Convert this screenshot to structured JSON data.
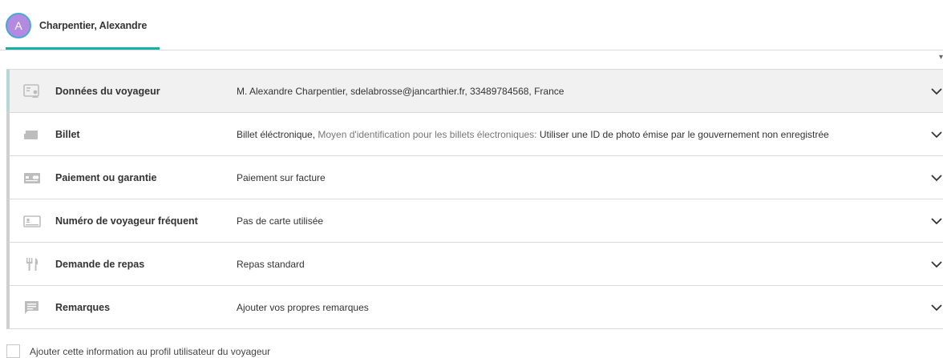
{
  "tab": {
    "avatar_letter": "A",
    "name": "Charpentier, Alexandre"
  },
  "rows": [
    {
      "title": "Données du voyageur",
      "value": "M. Alexandre Charpentier, sdelabrosse@jancarthier.fr, 33489784568, France",
      "icon": "id-card-icon"
    },
    {
      "title": "Billet",
      "value_prefix": "Billet éléctronique, ",
      "value_muted": "Moyen d'identification pour les billets électroniques: ",
      "value_suffix": "Utiliser une ID de photo émise par le gouvernement non enregistrée",
      "icon": "ticket-icon"
    },
    {
      "title": "Paiement ou garantie",
      "value": "Paiement sur facture",
      "icon": "credit-card-icon"
    },
    {
      "title": "Numéro de voyageur fréquent",
      "value": "Pas de carte utilisée",
      "icon": "membership-card-icon"
    },
    {
      "title": "Demande de repas",
      "value": "Repas standard",
      "icon": "fork-knife-icon"
    },
    {
      "title": "Remarques",
      "value": "Ajouter vos propres remarques",
      "icon": "comment-icon"
    }
  ],
  "footer": {
    "checkbox_label": "Ajouter cette information au profil utilisateur du voyageur"
  },
  "colors": {
    "accent": "#13b1a6",
    "avatar": "#b48ae0",
    "icon": "#bdbdbd"
  }
}
